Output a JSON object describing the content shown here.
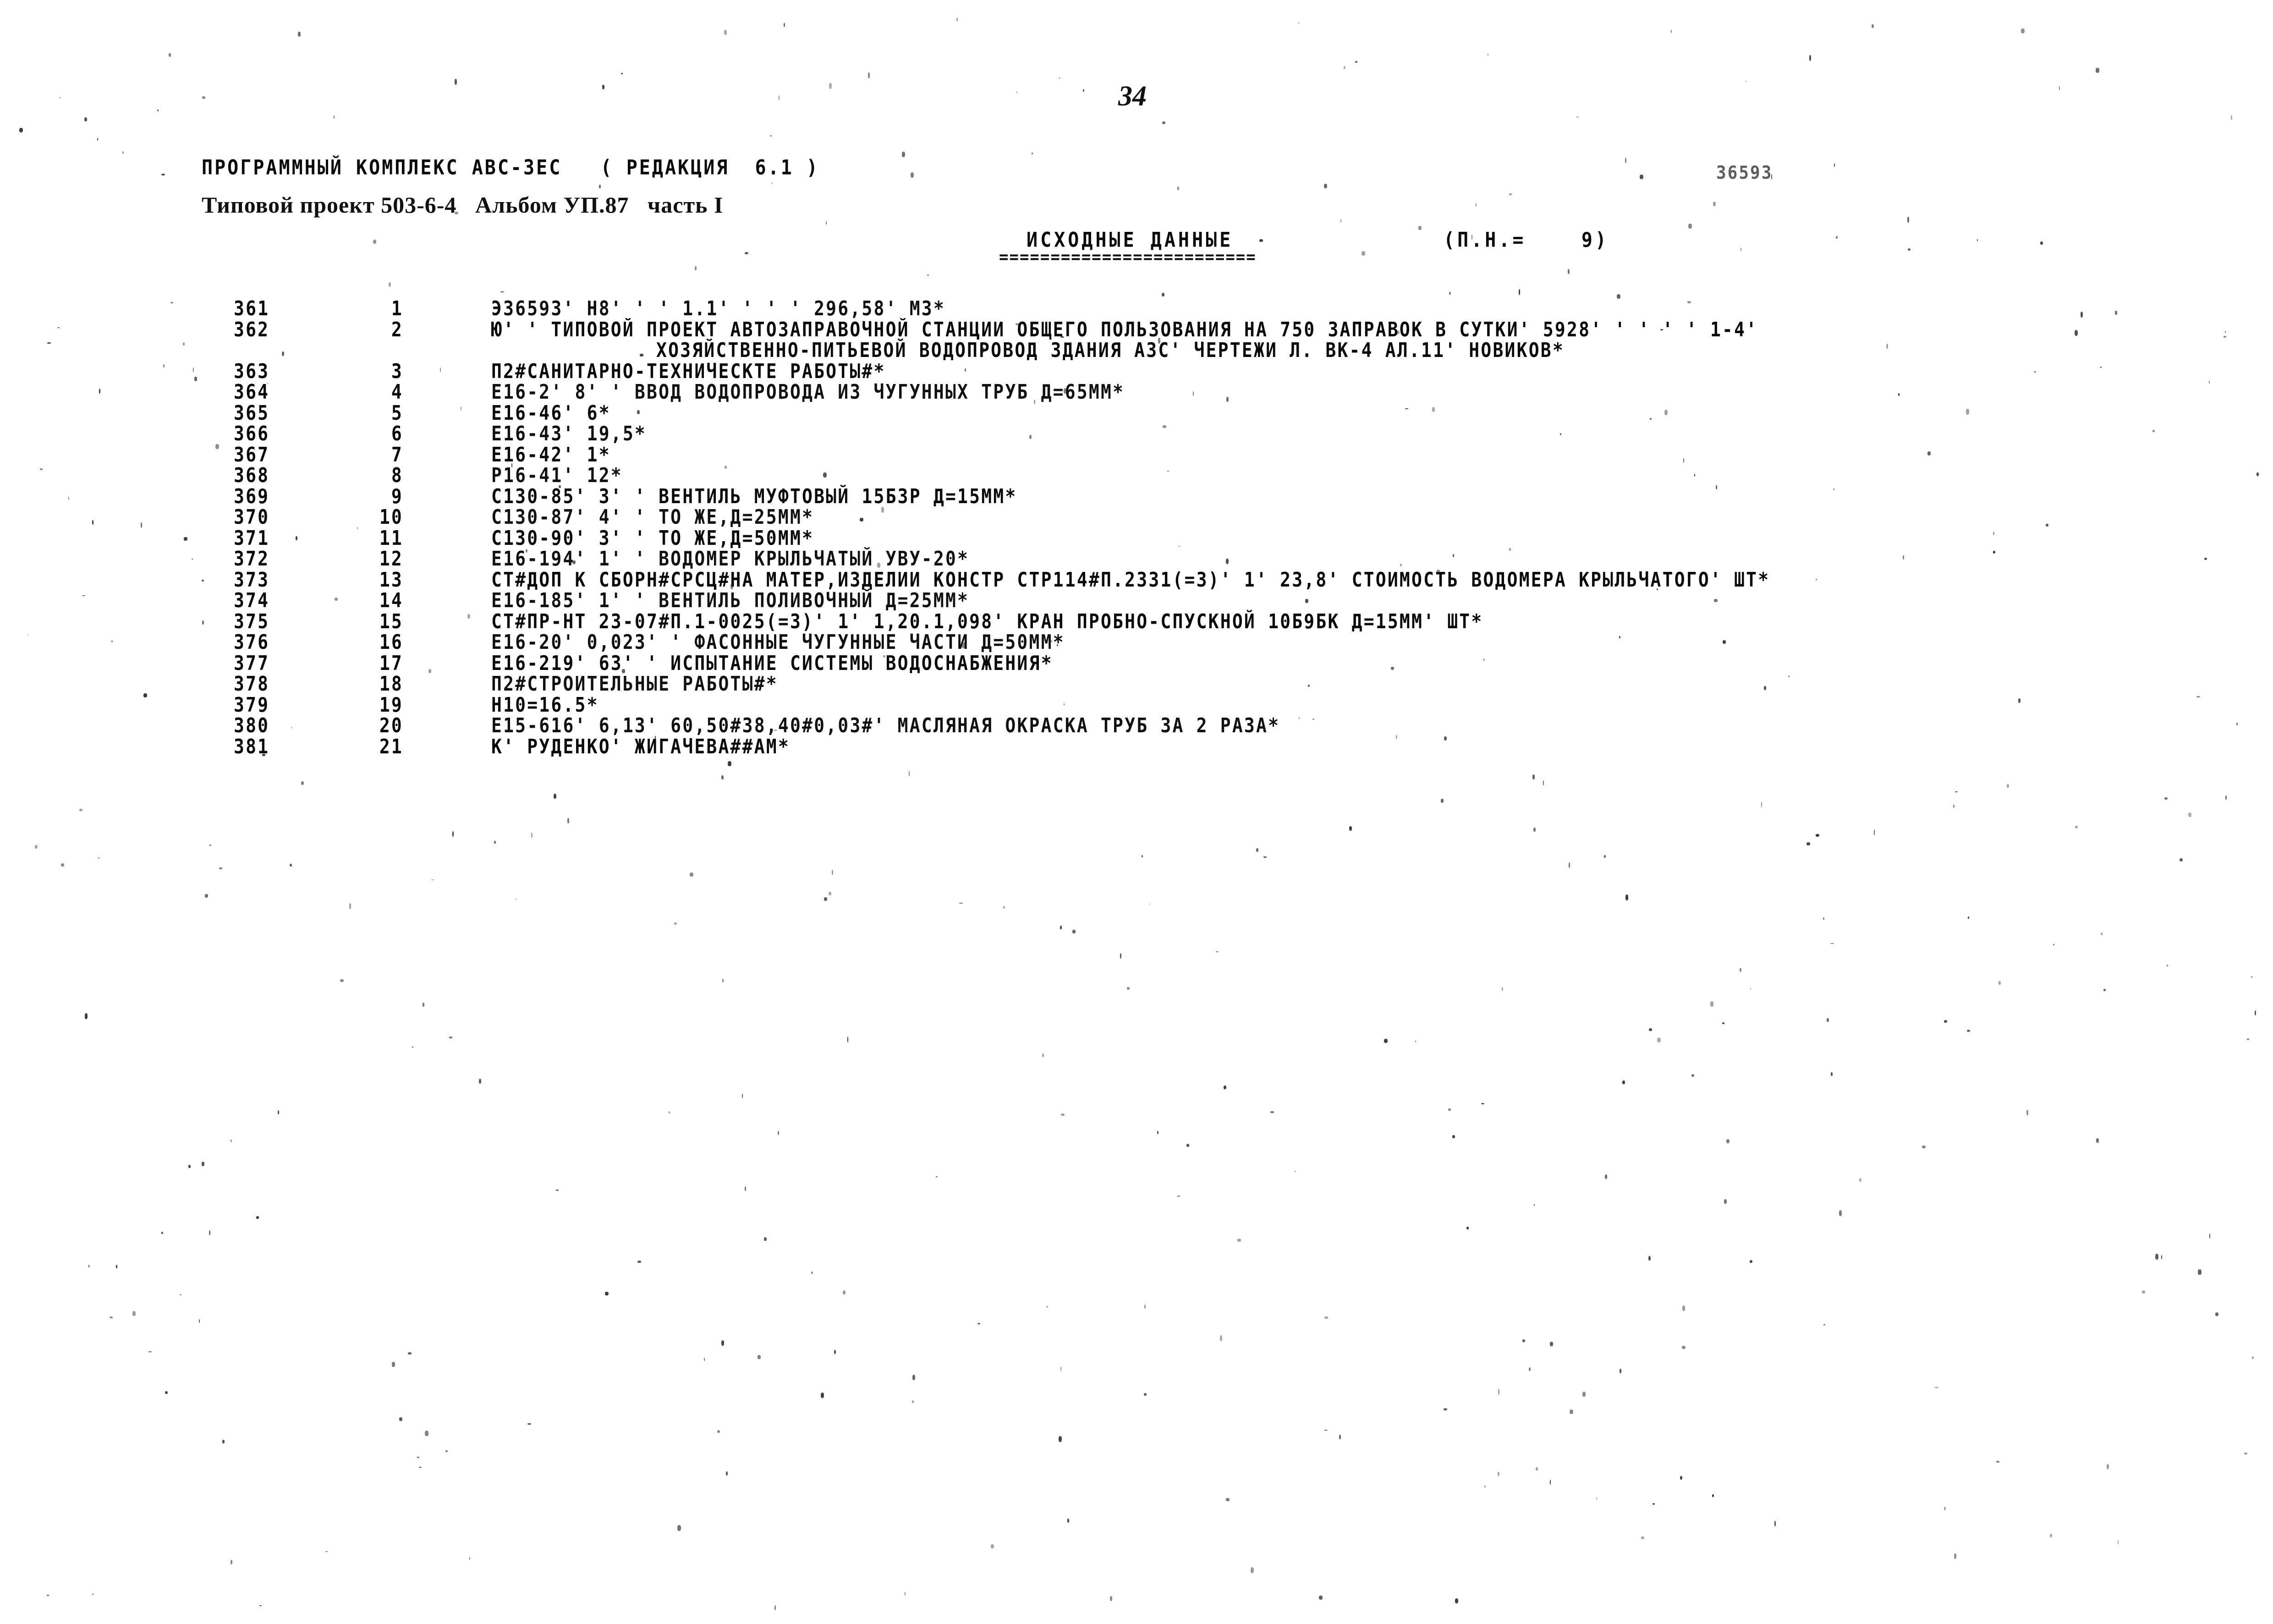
{
  "page": {
    "number": "34",
    "doc_code": "36593"
  },
  "header": {
    "program_line": "ПРОГРАММНЫЙ КОМПЛЕКС АВС-3ЕС   ( РЕДАКЦИЯ  6.1 )",
    "project_line": "Типовой проект 503-6-4   Альбом УП.87   часть I",
    "section_title": "ИСХОДНЫЕ ДАННЫЕ",
    "section_rule": "=========================",
    "section_meta": "(П.Н.=    9)"
  },
  "listing": {
    "columns": [
      "seq",
      "idx",
      "text"
    ],
    "rows": [
      {
        "seq": "361",
        "idx": "1",
        "text": "Э36593' Н8' ' ' 1.1' ' ' ' 296,58' М3*"
      },
      {
        "seq": "362",
        "idx": "2",
        "text": "Ю' ' ТИПОВОЙ ПРОЕКТ АВТОЗАПРАВОЧНОЙ СТАНЦИИ ОБЩЕГО ПОЛЬЗОВАНИЯ НА 750 ЗАПРАВОК В СУТКИ' 5928' ' ' ' ' 1-4'",
        "cont": "ХОЗЯЙСТВЕННО-ПИТЬЕВОЙ ВОДОПРОВОД ЗДАНИЯ АЗС' ЧЕРТЕЖИ Л. ВК-4 АЛ.11' НОВИКОВ*"
      },
      {
        "seq": "363",
        "idx": "3",
        "text": "П2#САНИТАРНО-ТЕХНИЧЕСКТЕ РАБОТЫ#*"
      },
      {
        "seq": "364",
        "idx": "4",
        "text": "Е16-2' 8' ' ВВОД ВОДОПРОВОДА ИЗ ЧУГУННЫХ ТРУБ Д=65ММ*"
      },
      {
        "seq": "365",
        "idx": "5",
        "text": "Е16-46' 6*"
      },
      {
        "seq": "366",
        "idx": "6",
        "text": "Е16-43' 19,5*"
      },
      {
        "seq": "367",
        "idx": "7",
        "text": "Е16-42' 1*"
      },
      {
        "seq": "368",
        "idx": "8",
        "text": "Р16-41' 12*"
      },
      {
        "seq": "369",
        "idx": "9",
        "text": "С130-85' 3' ' ВЕНТИЛЬ МУФТОВЫЙ 15Б3Р Д=15ММ*"
      },
      {
        "seq": "370",
        "idx": "10",
        "text": "С130-87' 4' ' ТО ЖЕ,Д=25ММ*"
      },
      {
        "seq": "371",
        "idx": "11",
        "text": "С130-90' 3' ' ТО ЖЕ,Д=50ММ*"
      },
      {
        "seq": "372",
        "idx": "12",
        "text": "Е16-194' 1' ' ВОДОМЕР КРЫЛЬЧАТЫЙ УВУ-20*"
      },
      {
        "seq": "373",
        "idx": "13",
        "text": "СТ#ДОП К СБОРН#СРСЦ#НА МАТЕР,ИЗДЕЛИИ КОНСТР СТР114#П.2331(=3)' 1' 23,8' СТОИМОСТЬ ВОДОМЕРА КРЫЛЬЧАТОГО' ШТ*"
      },
      {
        "seq": "374",
        "idx": "14",
        "text": "Е16-185' 1' ' ВЕНТИЛЬ ПОЛИВОЧНЫЙ Д=25ММ*"
      },
      {
        "seq": "375",
        "idx": "15",
        "text": "СТ#ПР-НТ 23-07#П.1-0025(=3)' 1' 1,20.1,098' КРАН ПРОБНО-СПУСКНОЙ 10Б9БК Д=15ММ' ШТ*"
      },
      {
        "seq": "376",
        "idx": "16",
        "text": "Е16-20' 0,023' ' ФАСОННЫЕ ЧУГУННЫЕ ЧАСТИ Д=50ММ*"
      },
      {
        "seq": "377",
        "idx": "17",
        "text": "Е16-219' 63' ' ИСПЫТАНИЕ СИСТЕМЫ ВОДОСНАБЖЕНИЯ*"
      },
      {
        "seq": "378",
        "idx": "18",
        "text": "П2#СТРОИТЕЛЬНЫЕ РАБОТЫ#*"
      },
      {
        "seq": "379",
        "idx": "19",
        "text": "Н10=16.5*"
      },
      {
        "seq": "380",
        "idx": "20",
        "text": "Е15-616' 6,13' 60,50#38,40#0,03#' МАСЛЯНАЯ ОКРАСКА ТРУБ ЗА 2 РАЗА*"
      },
      {
        "seq": "381",
        "idx": "21",
        "text": "К' РУДЕНКО' ЖИГАЧЕВА##АМ*"
      }
    ]
  }
}
